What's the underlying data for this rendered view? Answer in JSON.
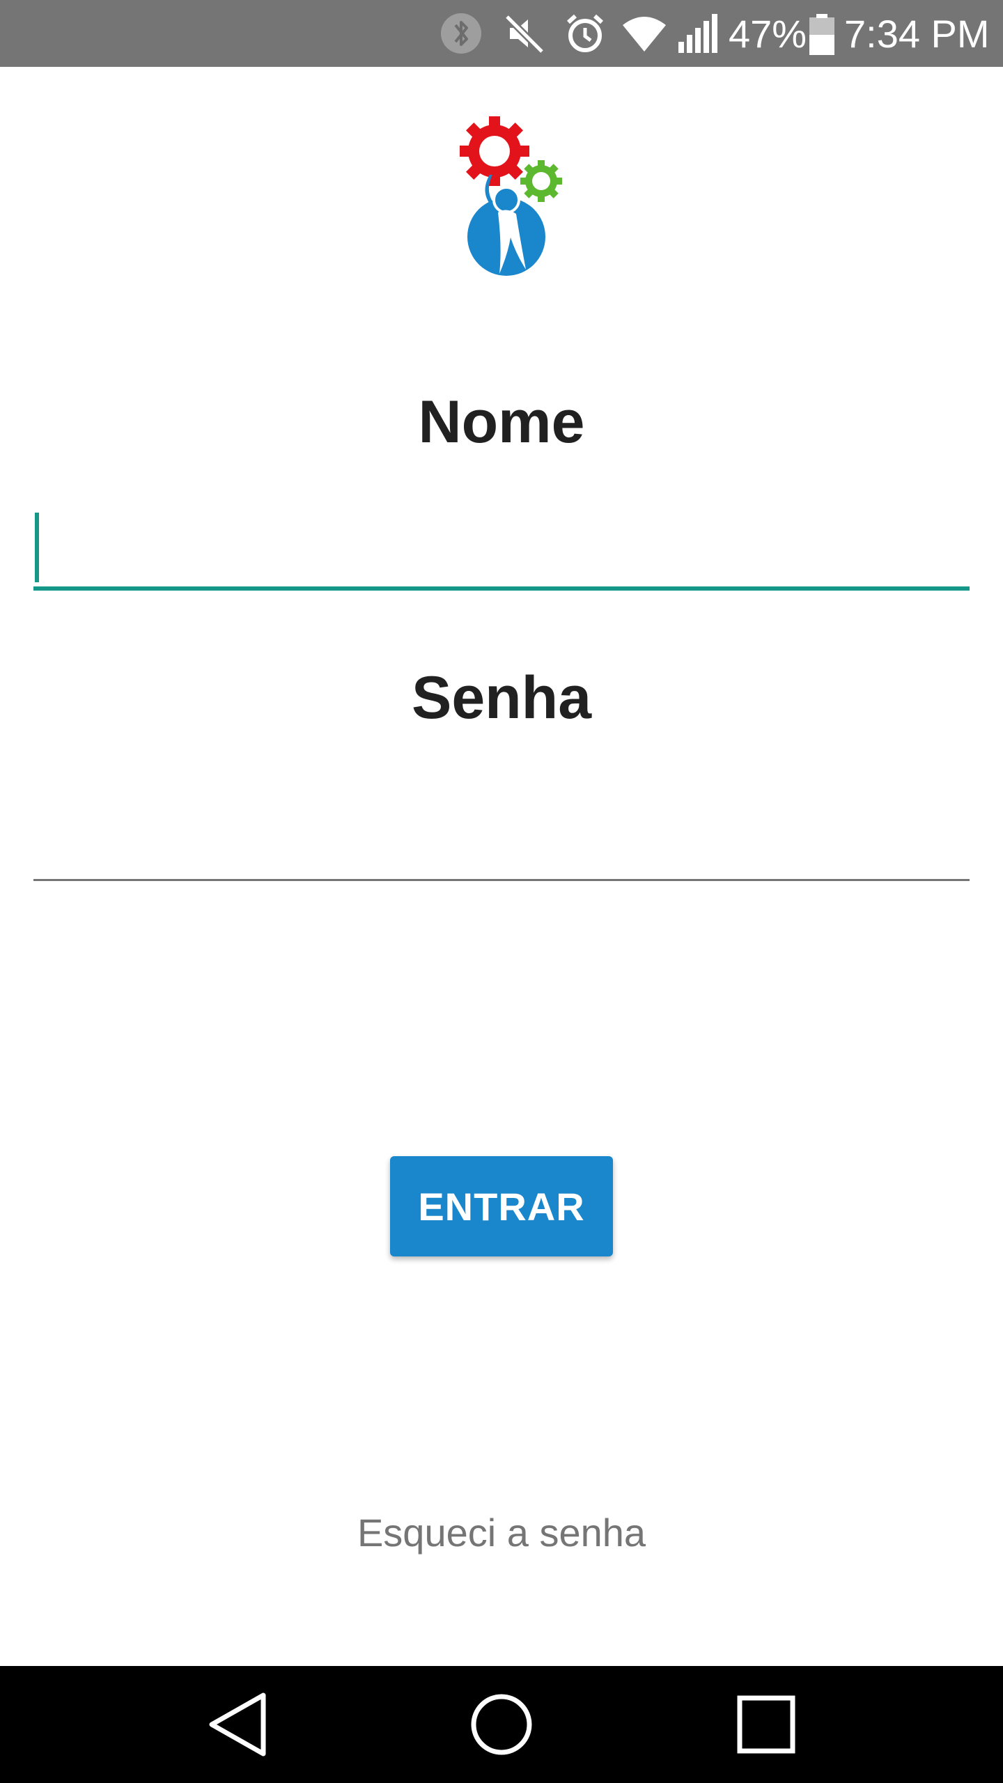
{
  "status_bar": {
    "battery_percent": "47%",
    "time": "7:34 PM",
    "icons": [
      "bluetooth-icon",
      "mute-icon",
      "alarm-icon",
      "wifi-icon",
      "signal-icon",
      "battery-icon"
    ]
  },
  "colors": {
    "accent": "#159789",
    "button": "#1a86cb",
    "status_bar": "#757575",
    "logo_red": "#e3131b",
    "logo_green": "#5cb82e",
    "logo_blue": "#1a86cb"
  },
  "form": {
    "name_label": "Nome",
    "name_value": "",
    "password_label": "Senha",
    "password_value": "",
    "submit_label": "ENTRAR",
    "forgot_label": "Esqueci a senha"
  },
  "nav_bar": {
    "buttons": [
      "back-icon",
      "home-icon",
      "recents-icon"
    ]
  }
}
